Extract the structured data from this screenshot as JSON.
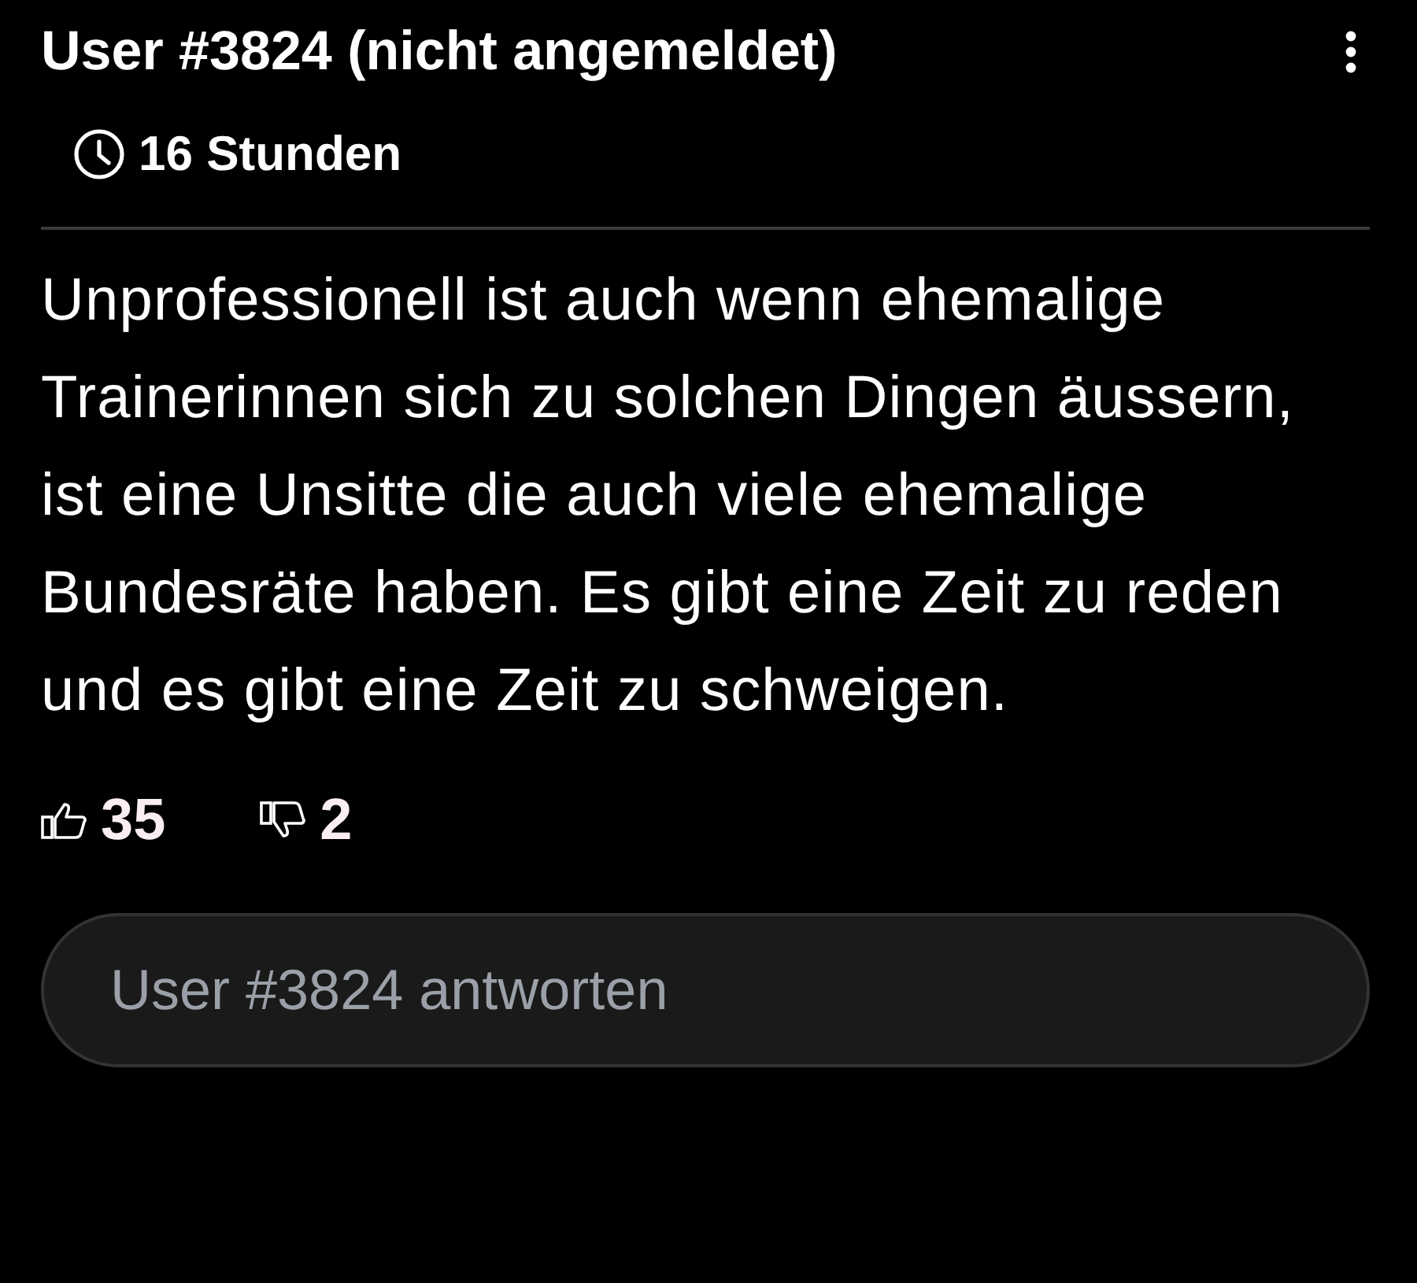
{
  "comment": {
    "author": "User #3824 (nicht angemeldet)",
    "time": "16 Stunden",
    "text": "Unprofessionell ist auch wenn ehemalige Trainerinnen sich zu solchen Dingen äussern, ist eine Unsitte die auch viele ehemalige Bundesräte haben. Es gibt eine Zeit zu reden und es gibt eine Zeit zu schweigen.",
    "likes": "35",
    "dislikes": "2"
  },
  "reply": {
    "placeholder": "User #3824 antworten"
  }
}
